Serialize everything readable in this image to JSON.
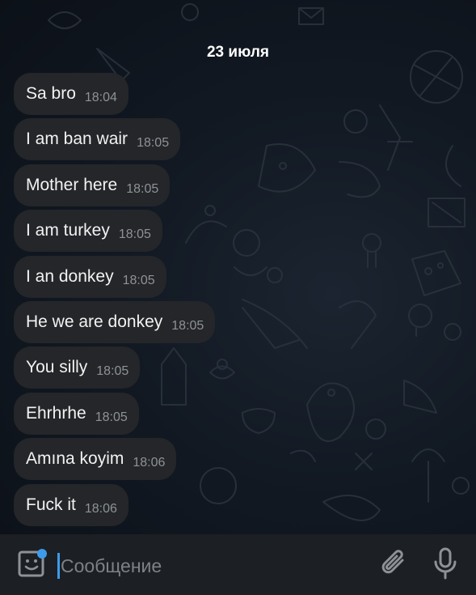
{
  "chat": {
    "date_separator": "23 июля",
    "messages": [
      {
        "text": "Sa bro",
        "time": "18:04"
      },
      {
        "text": "I am ban wair",
        "time": "18:05"
      },
      {
        "text": "Mother here",
        "time": "18:05"
      },
      {
        "text": "I am turkey",
        "time": "18:05"
      },
      {
        "text": "I an donkey",
        "time": "18:05"
      },
      {
        "text": "He we are donkey",
        "time": "18:05"
      },
      {
        "text": "You silly",
        "time": "18:05"
      },
      {
        "text": "Ehrhrhe",
        "time": "18:05"
      },
      {
        "text": "Amına koyim",
        "time": "18:06"
      },
      {
        "text": "Fuck it",
        "time": "18:06"
      }
    ]
  },
  "composer": {
    "placeholder": "Сообщение",
    "value": "",
    "icons": [
      "emoji-sticker-icon",
      "attach-paperclip-icon",
      "microphone-icon"
    ],
    "accent_color": "#3d9be9"
  },
  "colors": {
    "background": "#0e1621",
    "bubble": "#242629",
    "text": "#f2f2f2",
    "time": "#8e9297",
    "input_bar": "#1c1f24"
  }
}
